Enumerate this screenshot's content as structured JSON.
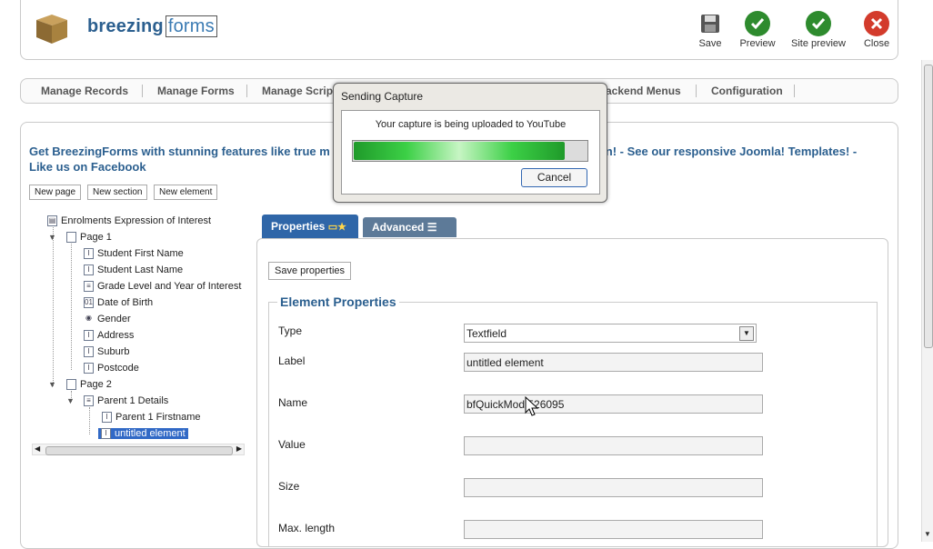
{
  "app": {
    "logo_main": "breezing",
    "logo_accent": "forms"
  },
  "toolbar": [
    {
      "label": "Save",
      "icon": "floppy-disk-icon",
      "color": "#555555"
    },
    {
      "label": "Preview",
      "icon": "check-circle-icon",
      "color": "#2e8b2e"
    },
    {
      "label": "Site preview",
      "icon": "check-circle-icon",
      "color": "#2e8b2e"
    },
    {
      "label": "Close",
      "icon": "close-circle-icon",
      "color": "#d33b2c"
    }
  ],
  "menu": [
    "Manage Records",
    "Manage Forms",
    "Manage Scrip",
    "ackend Menus",
    "Configuration"
  ],
  "promo": {
    "line1_start": "Get BreezingForms with stunning features like true m",
    "line1_end": "on! - See our responsive Joomla! Templates! -",
    "line2": "Like us on Facebook"
  },
  "buttons": {
    "new_page": "New page",
    "new_section": "New section",
    "new_element": "New element",
    "save_properties": "Save properties"
  },
  "tree": {
    "root": "Enrolments Expression of Interest",
    "page1": "Page 1",
    "page1_items": [
      "Student First Name",
      "Student Last Name",
      "Grade Level and Year of Interest",
      "Date of Birth",
      "Gender",
      "Address",
      "Suburb",
      "Postcode"
    ],
    "page2": "Page 2",
    "section": "Parent 1 Details",
    "section_items": [
      "Parent 1 Firstname",
      "untitled element"
    ]
  },
  "tabs": {
    "properties": "Properties",
    "advanced": "Advanced"
  },
  "element_properties": {
    "legend": "Element Properties",
    "fields": [
      {
        "label": "Type",
        "value": "Textfield"
      },
      {
        "label": "Label",
        "value": "untitled element"
      },
      {
        "label": "Name",
        "value": "bfQuickMod   526095"
      },
      {
        "label": "Value",
        "value": ""
      },
      {
        "label": "Size",
        "value": ""
      },
      {
        "label": "Max. length",
        "value": ""
      }
    ]
  },
  "dialog": {
    "title": "Sending Capture",
    "message": "Your capture is being uploaded to YouTube",
    "progress": 0.9,
    "cancel": "Cancel"
  }
}
